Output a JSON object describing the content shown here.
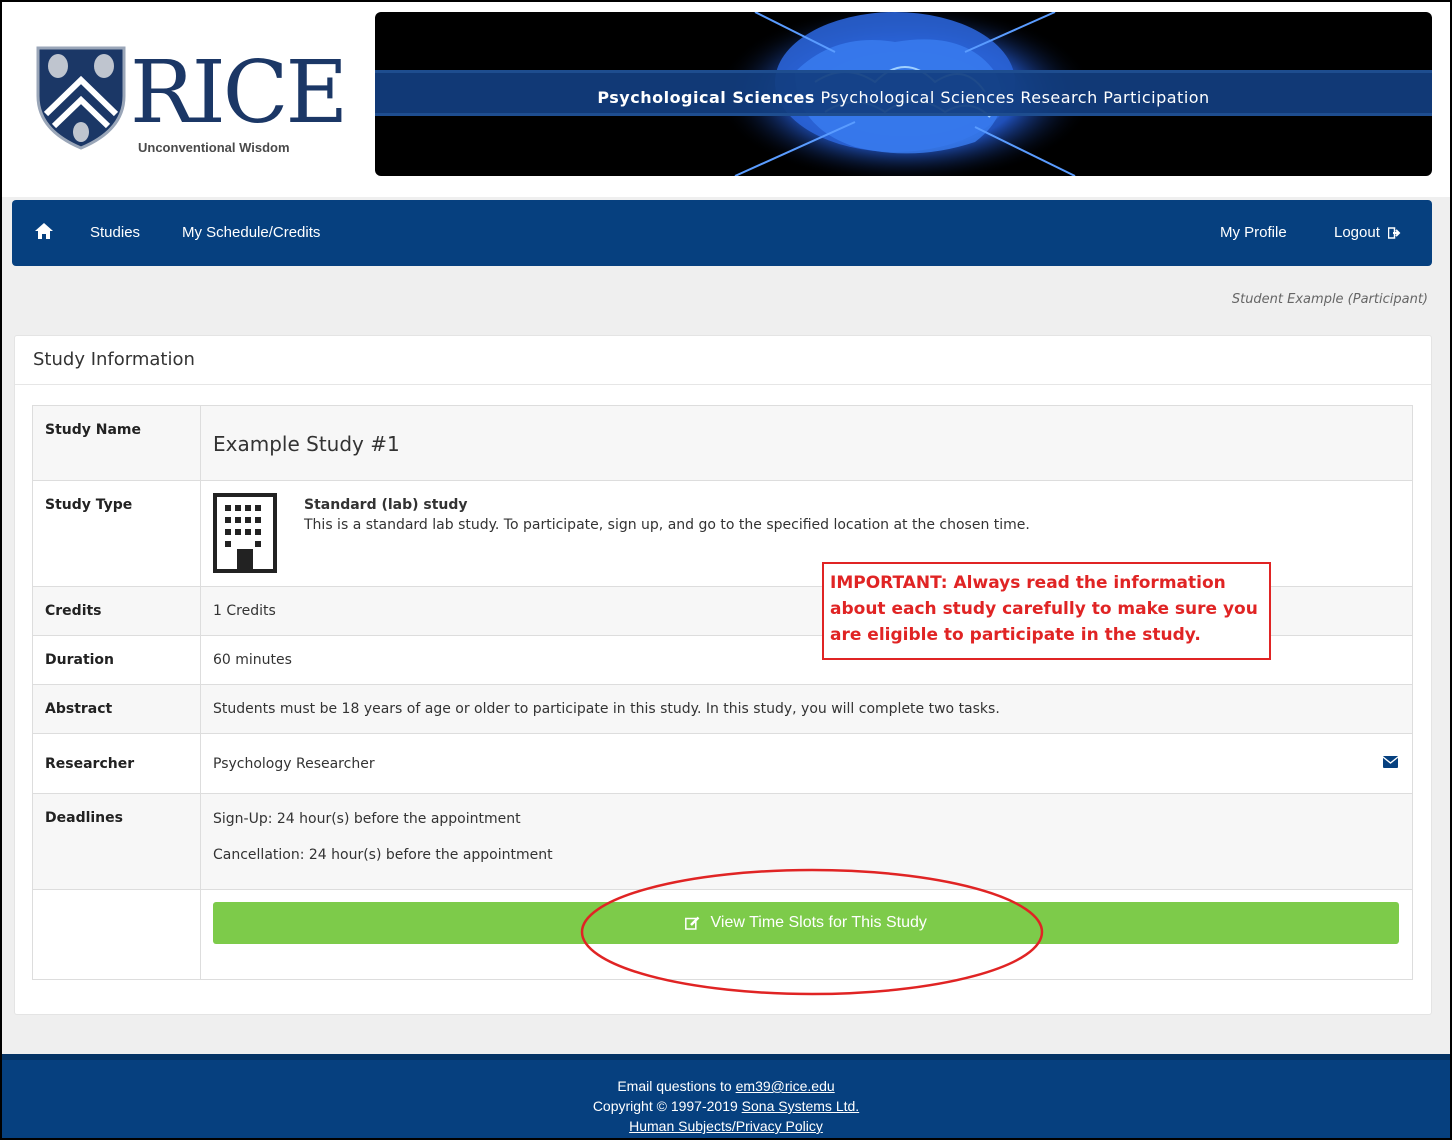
{
  "logo": {
    "wordmark": "RICE",
    "tagline": "Unconventional Wisdom"
  },
  "banner": {
    "department": "Psychological Sciences",
    "title": "Psychological Sciences Research Participation"
  },
  "nav": {
    "home_icon": "home-icon",
    "items": [
      "Studies",
      "My Schedule/Credits"
    ],
    "right_items": [
      "My Profile",
      "Logout"
    ]
  },
  "user": "Student Example (Participant)",
  "panel": {
    "title": "Study Information",
    "rows": {
      "name_label": "Study Name",
      "name_value": "Example Study #1",
      "type_label": "Study Type",
      "type_title": "Standard (lab) study",
      "type_desc": "This is a standard lab study. To participate, sign up, and go to the specified location at the chosen time.",
      "credits_label": "Credits",
      "credits_value": "1 Credits",
      "duration_label": "Duration",
      "duration_value": "60 minutes",
      "abstract_label": "Abstract",
      "abstract_value": "Students must be 18 years of age or older to participate in this study. In this study, you will complete two tasks.",
      "researcher_label": "Researcher",
      "researcher_value": "Psychology Researcher",
      "deadlines_label": "Deadlines",
      "signup": "Sign-Up:  24 hour(s) before the appointment",
      "cancellation": "Cancellation:  24 hour(s) before the appointment"
    },
    "button": "View Time Slots for This Study"
  },
  "annotation": {
    "text": "IMPORTANT: Always read the information about each study carefully to make sure you are eligible to participate in the study.",
    "color": "#e02424"
  },
  "footer": {
    "email_prefix": "Email questions to ",
    "email": "em39@rice.edu",
    "copyright_prefix": "Copyright © 1997-2019 ",
    "company": "Sona Systems Ltd.",
    "policy": "Human Subjects/Privacy Policy"
  },
  "colors": {
    "nav": "#06407f",
    "button": "#7dcb4a",
    "accent_red": "#e02424"
  }
}
